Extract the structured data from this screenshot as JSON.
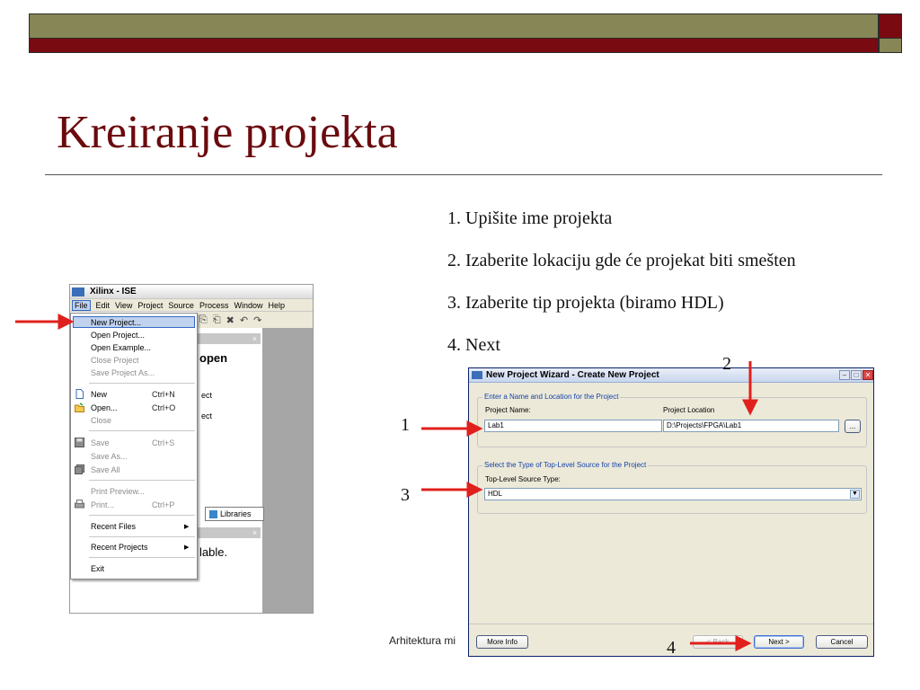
{
  "slide": {
    "title": "Kreiranje projekta",
    "steps": [
      "1. Upišite ime projekta",
      "2. Izaberite lokaciju gde će projekat biti smešten",
      "3. Izaberite tip projekta (biramo HDL)",
      "4. Next"
    ],
    "footer": "Arhitektura mi",
    "annotations": [
      "1",
      "2",
      "3",
      "4"
    ],
    "colors": {
      "maroon": "#7a0a12",
      "olive": "#868656",
      "arrow": "#e0201c"
    }
  },
  "ise": {
    "window_title": "Xilinx - ISE",
    "menu": [
      "File",
      "Edit",
      "View",
      "Project",
      "Source",
      "Process",
      "Window",
      "Help"
    ],
    "panel_text_open": "open",
    "panel_frag1": "ect",
    "panel_frag2": "ect",
    "libraries_tab": "Libraries",
    "panel_text_lable": "lable.",
    "close_glyph": "×",
    "file_menu": {
      "new_project": "New Project...",
      "open_project": "Open Project...",
      "open_example": "Open Example...",
      "close_project": "Close Project",
      "save_project_as": "Save Project As...",
      "new": "New",
      "new_sc": "Ctrl+N",
      "open": "Open...",
      "open_sc": "Ctrl+O",
      "close": "Close",
      "save": "Save",
      "save_sc": "Ctrl+S",
      "save_as": "Save As...",
      "save_all": "Save All",
      "print_preview": "Print Preview...",
      "print": "Print...",
      "print_sc": "Ctrl+P",
      "recent_files": "Recent Files",
      "recent_projects": "Recent Projects",
      "exit": "Exit"
    }
  },
  "wizard": {
    "title": "New Project Wizard - Create New Project",
    "group1_legend": "Enter a Name and Location for the Project",
    "project_name_label": "Project Name:",
    "project_name_value": "Lab1",
    "project_location_label": "Project Location",
    "project_location_value": "D:\\Projects\\FPGA\\Lab1",
    "browse_label": "...",
    "group2_legend": "Select the Type of Top-Level Source for the Project",
    "source_type_label": "Top-Level Source Type:",
    "source_type_value": "HDL",
    "more_info": "More Info",
    "back": "< Back",
    "next": "Next >",
    "cancel": "Cancel"
  }
}
